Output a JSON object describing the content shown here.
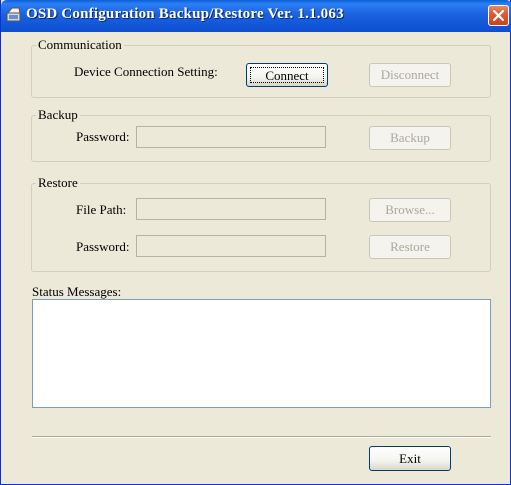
{
  "window": {
    "title": "OSD Configuration Backup/Restore   Ver. 1.1.063"
  },
  "icons": {
    "app": "app-icon",
    "close": "close-icon"
  },
  "communication": {
    "legend": "Communication",
    "device_label": "Device Connection Setting:",
    "connect_label": "Connect",
    "disconnect_label": "Disconnect"
  },
  "backup": {
    "legend": "Backup",
    "password_label": "Password:",
    "password_value": "",
    "backup_label": "Backup"
  },
  "restore": {
    "legend": "Restore",
    "file_path_label": "File Path:",
    "file_path_value": "",
    "browse_label": "Browse...",
    "password_label": "Password:",
    "password_value": "",
    "restore_label": "Restore"
  },
  "status": {
    "label": "Status Messages:",
    "text": ""
  },
  "footer": {
    "exit_label": "Exit"
  },
  "colors": {
    "titlebar": "#0c4ed2",
    "face": "#ece9d8",
    "close": "#e05a32"
  }
}
